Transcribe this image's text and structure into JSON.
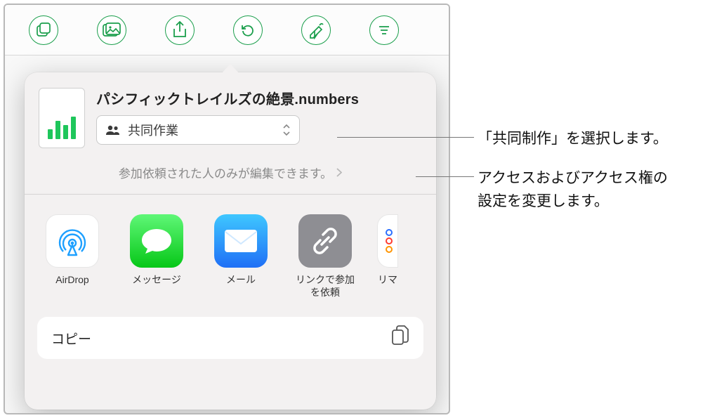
{
  "toolbar": {
    "icons": [
      "new-doc",
      "media",
      "share",
      "undo",
      "format",
      "more"
    ]
  },
  "share_sheet": {
    "file_title": "パシフィックトレイルズの絶景.numbers",
    "collab_label": "共同作業",
    "permission_text": "参加依頼された人のみが編集できます。",
    "apps": [
      {
        "id": "airdrop",
        "label": "AirDrop"
      },
      {
        "id": "messages",
        "label": "メッセージ"
      },
      {
        "id": "mail",
        "label": "メール"
      },
      {
        "id": "link",
        "label": "リンクで参加\nを依頼"
      },
      {
        "id": "reminders",
        "label": "リマ"
      }
    ],
    "copy_action": "コピー"
  },
  "callouts": {
    "collab": "「共同制作」を選択します。",
    "permission": "アクセスおよびアクセス権の\n設定を変更します。"
  }
}
